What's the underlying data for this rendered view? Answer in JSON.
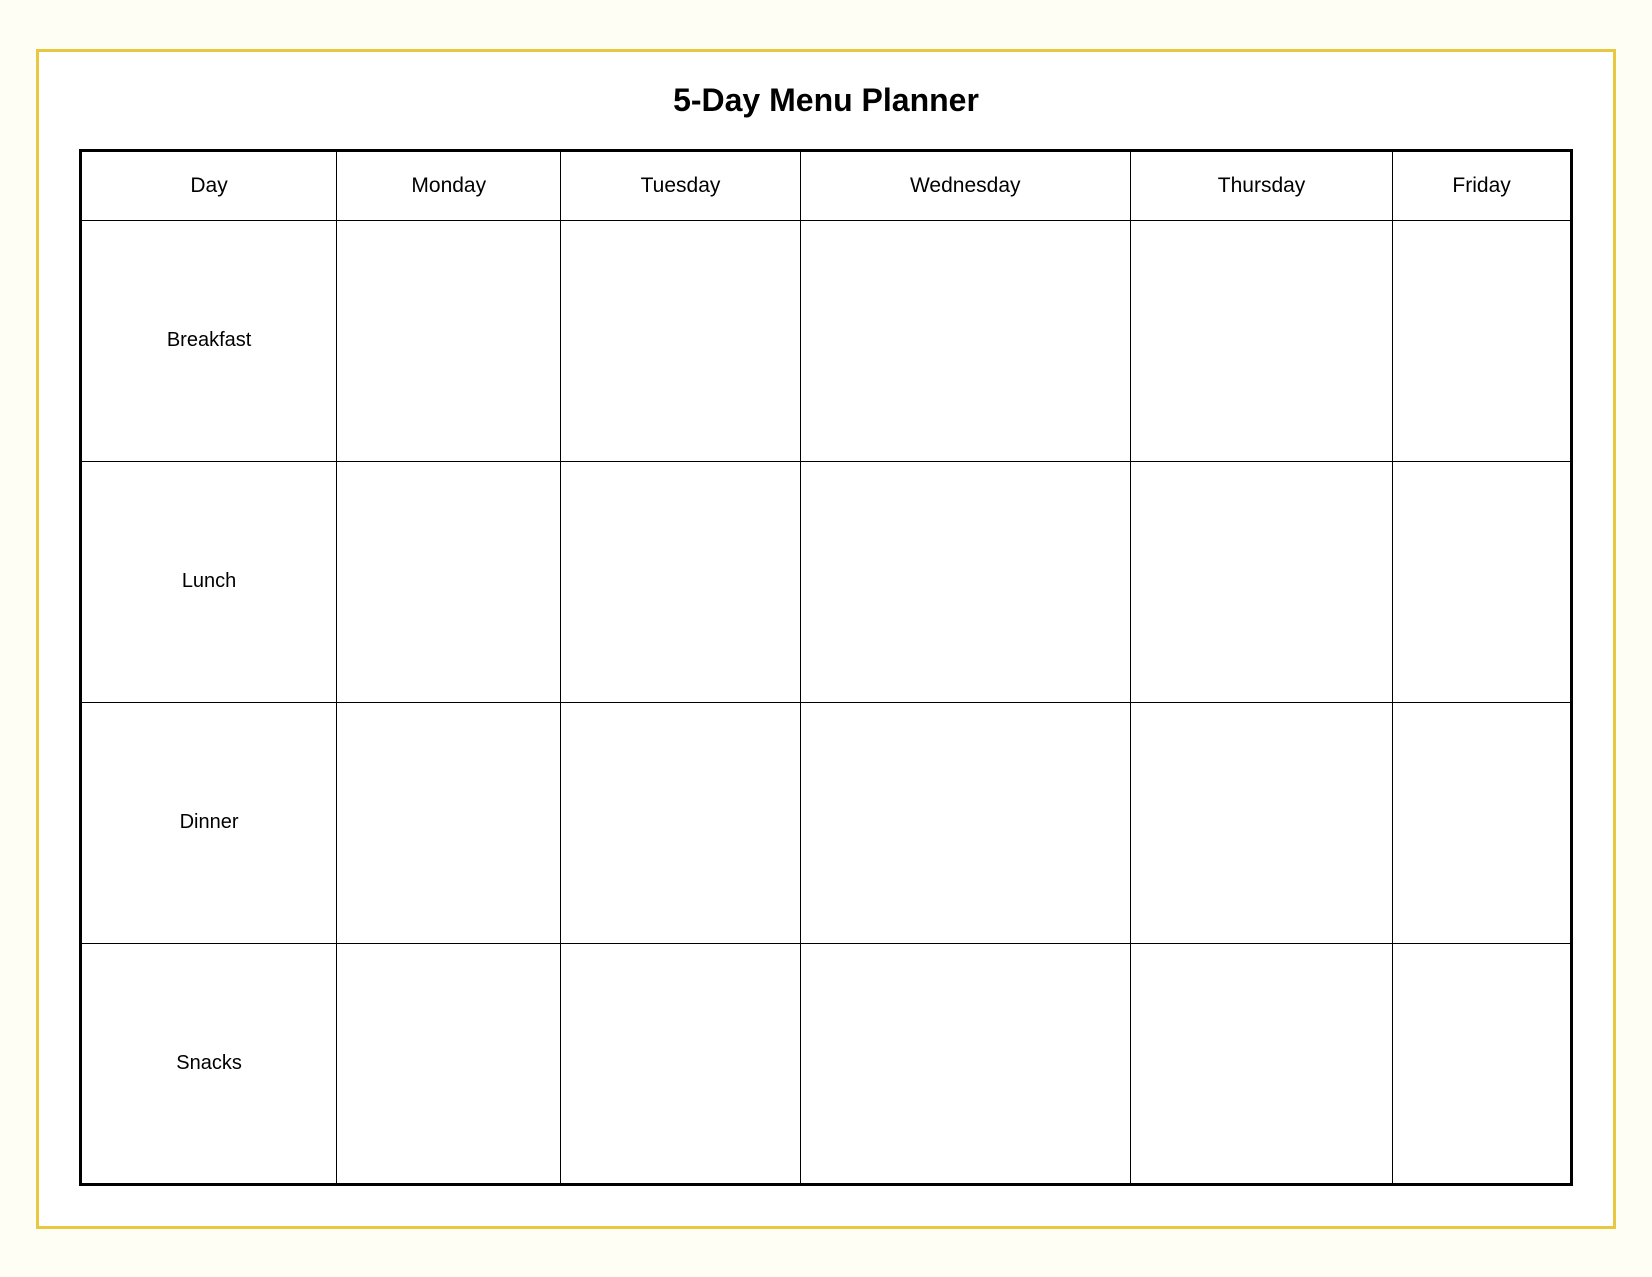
{
  "page": {
    "title": "5-Day Menu Planner",
    "background_color": "#fffef5",
    "border_color": "#e8c840"
  },
  "table": {
    "headers": [
      "Day",
      "Monday",
      "Tuesday",
      "Wednesday",
      "Thursday",
      "Friday"
    ],
    "rows": [
      {
        "label": "Breakfast",
        "cells": [
          "",
          "",
          "",
          "",
          ""
        ]
      },
      {
        "label": "Lunch",
        "cells": [
          "",
          "",
          "",
          "",
          ""
        ]
      },
      {
        "label": "Dinner",
        "cells": [
          "",
          "",
          "",
          "",
          ""
        ]
      },
      {
        "label": "Snacks",
        "cells": [
          "",
          "",
          "",
          "",
          ""
        ]
      }
    ]
  }
}
